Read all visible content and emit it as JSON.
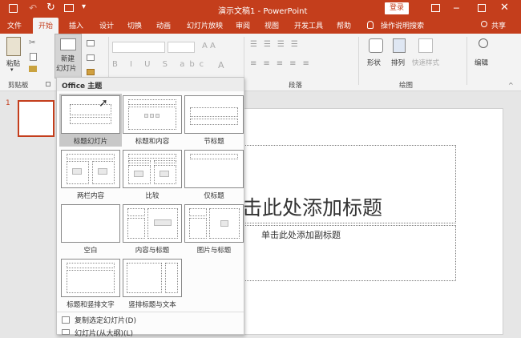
{
  "window": {
    "title": "演示文稿1 - PowerPoint",
    "login": "登录"
  },
  "tabs": [
    "文件",
    "开始",
    "插入",
    "设计",
    "切换",
    "动画",
    "幻灯片放映",
    "审阅",
    "视图",
    "开发工具",
    "帮助"
  ],
  "tell_me": "操作说明搜索",
  "share": "共享",
  "ribbon": {
    "paste": "粘贴",
    "clipboard": "剪贴板",
    "new_slide_line1": "新建",
    "new_slide_line2": "幻灯片",
    "paragraph": "段落",
    "drawing": "绘图",
    "shape": "形状",
    "arrange": "排列",
    "quick_styles": "快速样式",
    "edit": "编辑"
  },
  "dropdown": {
    "header": "Office 主题",
    "layouts": [
      "标题幻灯片",
      "标题和内容",
      "节标题",
      "两栏内容",
      "比较",
      "仅标题",
      "空白",
      "内容与标题",
      "图片与标题",
      "标题和竖排文字",
      "竖排标题与文本"
    ],
    "menu": [
      "复制选定幻灯片(D)",
      "幻灯片(从大纲)(L)"
    ]
  },
  "thumbnail_number": "1",
  "slide": {
    "title_placeholder": "击此处添加标题",
    "subtitle_placeholder": "单击此处添加副标题"
  }
}
